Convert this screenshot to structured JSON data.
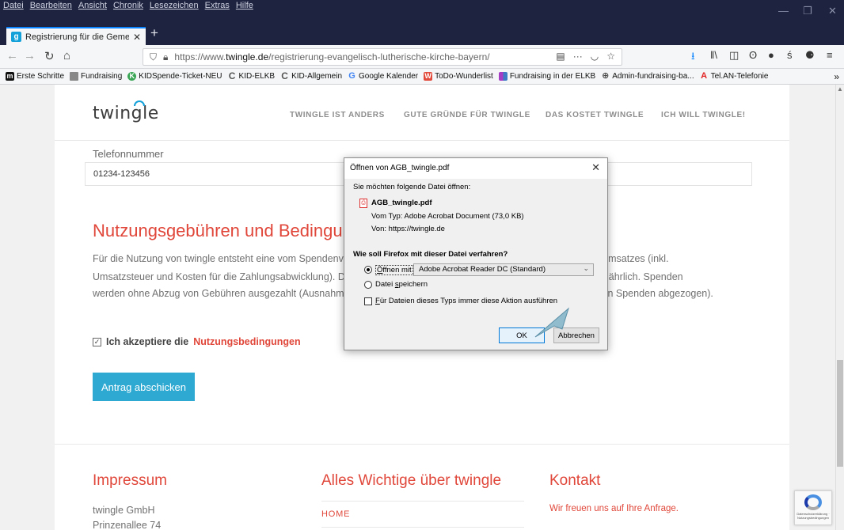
{
  "menubar": {
    "items": [
      "Datei",
      "Bearbeiten",
      "Ansicht",
      "Chronik",
      "Lesezeichen",
      "Extras",
      "Hilfe"
    ]
  },
  "tab": {
    "title": "Registrierung für die Gemeinde",
    "favicon": "g"
  },
  "navbar": {
    "url_prefix": "https://www.",
    "url_domain": "twingle.de",
    "url_path": "/registrierung-evangelisch-lutherische-kirche-bayern/",
    "page_actions": "···"
  },
  "bookmarks": [
    {
      "label": "Erste Schritte",
      "icon": "m-icon",
      "color": "#111111",
      "glyph": "m"
    },
    {
      "label": "Fundraising",
      "icon": "folder-icon",
      "color": "#777777",
      "glyph": ""
    },
    {
      "label": "KIDSpende-Ticket-NEU",
      "icon": "kid-icon",
      "color": "#3aa655",
      "glyph": "K"
    },
    {
      "label": "KID-ELKB",
      "icon": "c-icon",
      "color": "#555555",
      "glyph": "C"
    },
    {
      "label": "KID-Allgemein",
      "icon": "c-icon",
      "color": "#555555",
      "glyph": "C"
    },
    {
      "label": "Google Kalender",
      "icon": "google-icon",
      "color": "#4285f4",
      "glyph": "G"
    },
    {
      "label": "ToDo-Wunderlist",
      "icon": "wunderlist-icon",
      "color": "#e24b3b",
      "glyph": "W"
    },
    {
      "label": "Fundraising in der ELKB",
      "icon": "bars-icon",
      "color": "#a43dc4",
      "glyph": ""
    },
    {
      "label": "Admin-fundraising-ba...",
      "icon": "globe-icon",
      "color": "#444444",
      "glyph": "⊕"
    },
    {
      "label": "Tel.AN-Telefonie",
      "icon": "a-icon",
      "color": "#e22222",
      "glyph": "A"
    }
  ],
  "site": {
    "logo": "twingle",
    "nav": [
      "TWINGLE IST ANDERS",
      "GUTE GRÜNDE FÜR TWINGLE",
      "DAS KOSTET TWINGLE",
      "ICH WILL TWINGLE!"
    ]
  },
  "form": {
    "phone_label": "Telefonnummer",
    "phone_value": "01234-123456",
    "section_heading": "Nutzungsgebühren und Bedingungen",
    "paragraph": [
      "Für die Nutzung von twingle entsteht eine vom Spendenvolumen abhängige Gebühr in Höhe von 2,5% des Spendenumsatzes (inkl.",
      "Umsatzsteuer und Kosten für die Zahlungsabwicklung). Die Auszahlung der Spenden an die Organisation erfolgt halbjährlich. Spenden",
      "werden ohne Abzug von Gebühren ausgezahlt (Ausnahme: ... Gebühren werden bei der nächsten Auszahlung von den Spenden abgezogen)."
    ],
    "accept_prefix": "Ich akzeptiere die",
    "accept_link": "Nutzungsbedingungen",
    "submit_label": "Antrag abschicken"
  },
  "footer": {
    "col1_heading": "Impressum",
    "col1_lines": [
      "twingle GmbH",
      "Prinzenallee 74"
    ],
    "col2_heading": "Alles Wichtige über twingle",
    "col2_link": "HOME",
    "col3_heading": "Kontakt",
    "col3_text": "Wir freuen uns auf Ihre Anfrage."
  },
  "recaptcha": {
    "text": "Datenschutzerklärung · Nutzungsbedingungen"
  },
  "dialog": {
    "title": "Öffnen von AGB_twingle.pdf",
    "intro": "Sie möchten folgende Datei öffnen:",
    "filename": "AGB_twingle.pdf",
    "type_line": "Vom Typ: Adobe Acrobat Document (73,0 KB)",
    "from_line": "Von: https://twingle.de",
    "question": "Wie soll Firefox mit dieser Datei verfahren?",
    "open_with_label_u": "Ö",
    "open_with_label_rest": "ffnen mit",
    "open_with_app": "Adobe Acrobat Reader DC (Standard)",
    "save_label_pre": "Datei ",
    "save_label_u": "s",
    "save_label_rest": "peichern",
    "always_u": "F",
    "always_rest": "ür Dateien dieses Typs immer diese Aktion ausführen",
    "ok_label": "OK",
    "cancel_label": "Abbrechen",
    "selected_option": "open_with",
    "always_checked": false
  },
  "colors": {
    "accent_red": "#e0473a",
    "accent_blue": "#2ea9d2",
    "chrome_dark": "#1e2340"
  }
}
